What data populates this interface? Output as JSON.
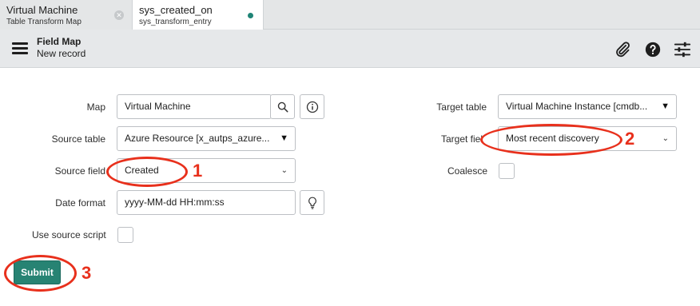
{
  "tabs": [
    {
      "title": "Virtual Machine",
      "subtitle": "Table Transform Map"
    },
    {
      "title": "sys_created_on",
      "subtitle": "sys_transform_entry"
    }
  ],
  "header": {
    "title": "Field Map",
    "subtitle": "New record"
  },
  "icons": {
    "tab_close": "close-icon",
    "tab_modified": "dot-icon",
    "menu": "hamburger-icon",
    "attach": "paperclip-icon",
    "help": "help-icon",
    "settings": "sliders-icon",
    "search": "search-icon",
    "info": "info-icon",
    "hint": "lightbulb-icon"
  },
  "form": {
    "map": {
      "label": "Map",
      "value": "Virtual Machine"
    },
    "source_table": {
      "label": "Source table",
      "value": "Azure Resource [x_autps_azure..."
    },
    "source_field": {
      "label": "Source field",
      "value": "Created"
    },
    "date_format": {
      "label": "Date format",
      "value": "yyyy-MM-dd HH:mm:ss"
    },
    "use_source_script": {
      "label": "Use source script",
      "checked": false
    },
    "target_table": {
      "label": "Target table",
      "value": "Virtual Machine Instance [cmdb..."
    },
    "target_field": {
      "label": "Target fiel",
      "value": "Most recent discovery"
    },
    "coalesce": {
      "label": "Coalesce",
      "checked": false
    },
    "submit_label": "Submit"
  },
  "annotations": {
    "one": "1",
    "two": "2",
    "three": "3",
    "color": "#e8301c"
  },
  "colors": {
    "accent": "#278373",
    "tab_dot": "#1f8476",
    "header_bg": "#e6e8ea"
  }
}
